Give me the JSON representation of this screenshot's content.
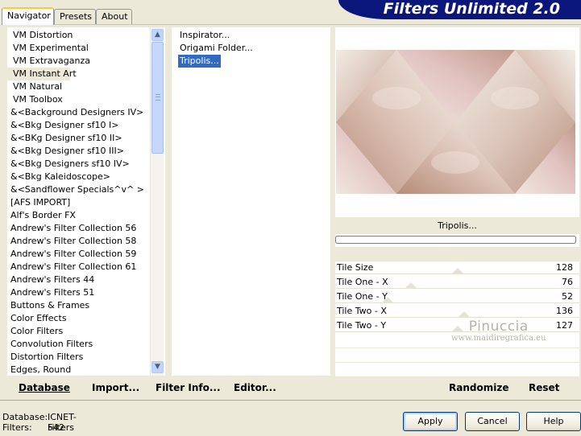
{
  "tabs": [
    "Navigator",
    "Presets",
    "About"
  ],
  "app_title": "Filters Unlimited 2.0",
  "categories": [
    "VM Distortion",
    "VM Experimental",
    "VM Extravaganza",
    "VM Instant Art",
    "VM Natural",
    "VM Toolbox",
    "&<Background Designers IV>",
    "&<Bkg Designer sf10 I>",
    "&<BKg Designer sf10 II>",
    "&<Bkg Designer sf10 III>",
    "&<Bkg Designers sf10 IV>",
    "&<Bkg Kaleidoscope>",
    "&<Sandflower Specials^v^ >",
    "[AFS IMPORT]",
    "Alf's Border FX",
    "Andrew's Filter Collection 56",
    "Andrew's Filter Collection 58",
    "Andrew's Filter Collection 59",
    "Andrew's Filter Collection 61",
    "Andrew's Filters 44",
    "Andrew's Filters 51",
    "Buttons & Frames",
    "Color Effects",
    "Color Filters",
    "Convolution Filters",
    "Distortion Filters",
    "Edges, Round"
  ],
  "selected_category": "VM Instant Art",
  "filters": [
    "Inspirator...",
    "Origami Folder...",
    "Tripolis..."
  ],
  "selected_filter": "Tripolis...",
  "preview": {
    "filter_name": "Tripolis...",
    "progress_percent": 0,
    "colors": {
      "tile_light": "#efe6dc",
      "tile_mid": "#d9bdb2",
      "tile_dark": "#b7907d",
      "tile_pink": "#e6c7c7"
    }
  },
  "parameters": [
    {
      "label": "Tile Size",
      "value": "128",
      "slider": 0.5
    },
    {
      "label": "Tile One - X",
      "value": "76",
      "slider": 0.3
    },
    {
      "label": "Tile One - Y",
      "value": "52",
      "slider": 0.2
    },
    {
      "label": "Tile Two - X",
      "value": "136",
      "slider": 0.53
    },
    {
      "label": "Tile Two - Y",
      "value": "127",
      "slider": 0.5
    }
  ],
  "watermark": {
    "name": "Pinuccia",
    "site": "www.maidiregrafica.eu"
  },
  "links": {
    "database": "Database",
    "import": "Import...",
    "filter_info": "Filter Info...",
    "editor": "Editor...",
    "randomize": "Randomize",
    "reset": "Reset"
  },
  "footer": {
    "database_label": "Database:",
    "database_value": "ICNET-Filters",
    "filters_label": "Filters:",
    "filters_value": "542"
  },
  "buttons": {
    "apply": "Apply",
    "cancel": "Cancel",
    "help": "Help"
  },
  "scroll_icons": {
    "up": "chevron-up-icon",
    "down": "chevron-down-icon"
  }
}
